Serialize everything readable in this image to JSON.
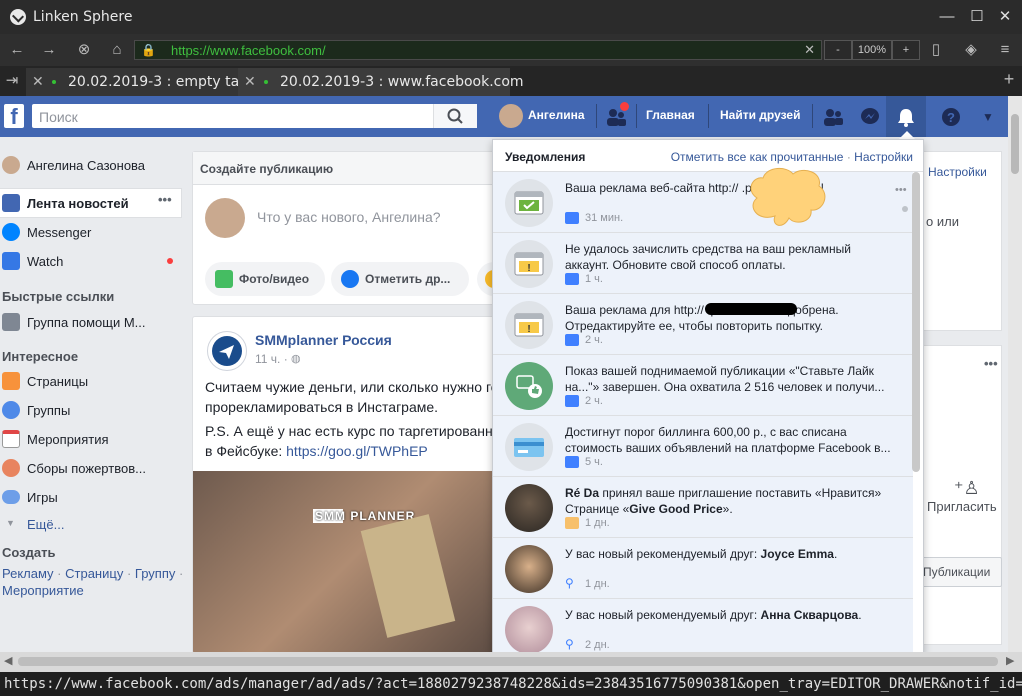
{
  "browser": {
    "app_title": "Linken Sphere",
    "url": "https://www.facebook.com/",
    "zoom": "100%",
    "zoom_minus": "-",
    "zoom_plus": "+",
    "tabs": [
      {
        "label": "20.02.2019-3 : empty tab"
      },
      {
        "label": "20.02.2019-3 : www.facebook.com"
      }
    ],
    "status_url": "https://www.facebook.com/ads/manager/ad/ads/?act=1880279238748228&ids=23843516775090381&open_tray=EDITOR_DRAWER&notif_id=155112"
  },
  "fb_header": {
    "search_placeholder": "Поиск",
    "profile_name": "Ангелина",
    "home": "Главная",
    "find_friends": "Найти друзей"
  },
  "sidebar": {
    "profile": "Ангелина Сазонова",
    "items": [
      {
        "label": "Лента новостей"
      },
      {
        "label": "Messenger"
      },
      {
        "label": "Watch"
      }
    ],
    "quick_links_header": "Быстрые ссылки",
    "quick_links": [
      {
        "label": "Группа помощи М..."
      }
    ],
    "interesting_header": "Интересное",
    "interesting": [
      {
        "label": "Страницы"
      },
      {
        "label": "Группы"
      },
      {
        "label": "Мероприятия"
      },
      {
        "label": "Сборы пожертвов..."
      },
      {
        "label": "Игры"
      }
    ],
    "more": "Ещё...",
    "create_header": "Создать",
    "create_links": [
      "Рекламу",
      "Страницу",
      "Группу",
      "Мероприятие"
    ]
  },
  "composer": {
    "title": "Создайте публикацию",
    "placeholder": "Что у вас нового, Ангелина?",
    "photo_btn": "Фото/видео",
    "tag_btn": "Отметить др..."
  },
  "post": {
    "author": "SMMplanner Россия",
    "time": "11 ч. ·",
    "text1": "Считаем чужие деньги, или сколько нужно го",
    "text2": "прорекламироваться в Инстаграме.",
    "text3": "P.S. А ещё у нас есть курс по таргетированн",
    "text4a": "в Фейсбуке: ",
    "text4b": "https://goo.gl/TWPhEP",
    "image_label": "SMM PLANNER"
  },
  "right_col": {
    "settings": "Настройки",
    "text_fragment": "о или",
    "invite": "Пригласить",
    "publications": "Публикации"
  },
  "notifications": {
    "title": "Уведомления",
    "mark_all": "Отметить все как прочитанные",
    "sep": " · ",
    "settings": "Настройки",
    "items": [
      {
        "text": "Ваша реклама веб-сайта http://                              .pw/ одобрена!",
        "time": "31 мин."
      },
      {
        "text": "Не удалось зачислить средства на ваш рекламный аккаунт. Обновите свой способ оплаты.",
        "time": "1 ч."
      },
      {
        "text": "Ваша реклама для http://                           .pw/ не была одобрена. Отредактируйте ее, чтобы повторить попытку.",
        "time": "2 ч."
      },
      {
        "text": "Показ вашей поднимаемой публикации «\"Ставьте Лайк на...\"» завершен. Она охватила 2 516 человек и получи...",
        "time": "2 ч."
      },
      {
        "text": "Достигнут порог биллинга 600,00 р., с вас списана стоимость ваших объявлений на платформе Facebook в...",
        "time": "5 ч."
      },
      {
        "text_a": "Ré Da",
        "text_b": " принял ваше приглашение поставить «Нравится» Странице «",
        "text_c": "Give Good Price",
        "text_d": "».",
        "time": "1 дн."
      },
      {
        "text_a": "У вас новый рекомендуемый друг: ",
        "text_b": "Joyce Emma",
        "text_c": ".",
        "time": "1 дн."
      },
      {
        "text_a": "У вас новый рекомендуемый друг: ",
        "text_b": "Анна Скварцова",
        "text_c": ".",
        "time": "2 дн."
      }
    ]
  },
  "colors": {
    "fb_blue": "#4267b2",
    "link": "#365899",
    "unread_bg": "#edf2fa",
    "browser_dark": "#2b2b2b",
    "url_green": "#3fbf3f"
  }
}
